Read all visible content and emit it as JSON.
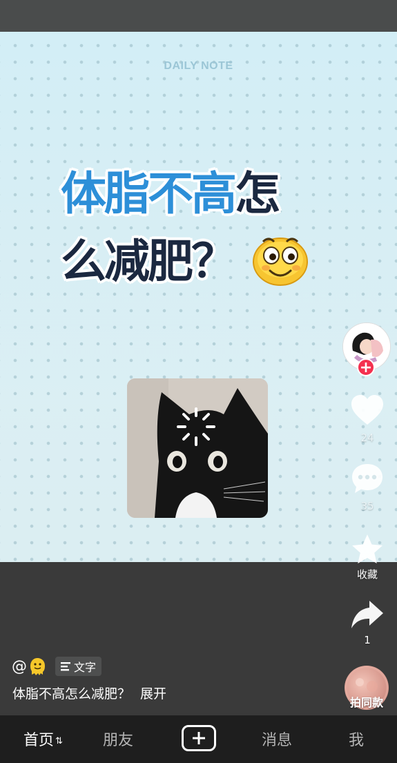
{
  "video": {
    "brand_text": "DAILY NOTE",
    "headline_part1_blue": "体脂不高",
    "headline_part1_dark": "怎",
    "headline_line2": "么减肥？"
  },
  "right_rail": {
    "like_count": "24",
    "comment_count": "35",
    "favorite_label": "收藏",
    "share_count": "1",
    "same_style_label": "拍同款"
  },
  "caption": {
    "at_sign": "@",
    "tag_label": "文字",
    "text": "体脂不高怎么减肥？",
    "expand_label": "展开"
  },
  "nav": {
    "home": "首页",
    "friends": "朋友",
    "messages": "消息",
    "me": "我"
  },
  "colors": {
    "accent_blue": "#2d8fd8",
    "follow_red": "#f4304f",
    "background_teal": "#d9eef3"
  }
}
